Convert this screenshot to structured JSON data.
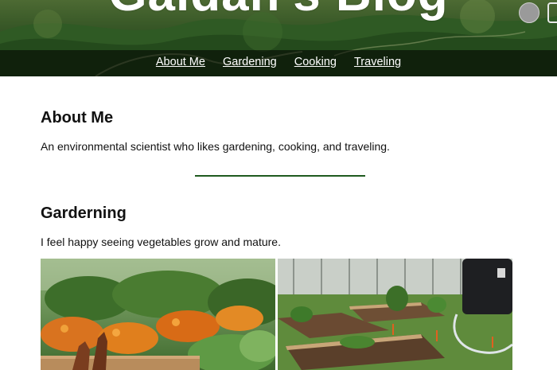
{
  "header": {
    "title": "Gaidan's Blog",
    "nav": [
      "About Me",
      "Gardening",
      "Cooking",
      "Traveling"
    ]
  },
  "about": {
    "heading": "About Me",
    "text": "An environmental scientist who likes gardening, cooking, and traveling."
  },
  "gardening": {
    "heading": "Garderning",
    "text": "I feel happy seeing vegetables grow and mature."
  },
  "colors": {
    "divider": "#1f5a1f",
    "nav_band": "rgba(0,0,0,0.55)",
    "header_green": "#3a5a28"
  },
  "icons": [
    "theme-toggle-icon",
    "device-icon"
  ]
}
